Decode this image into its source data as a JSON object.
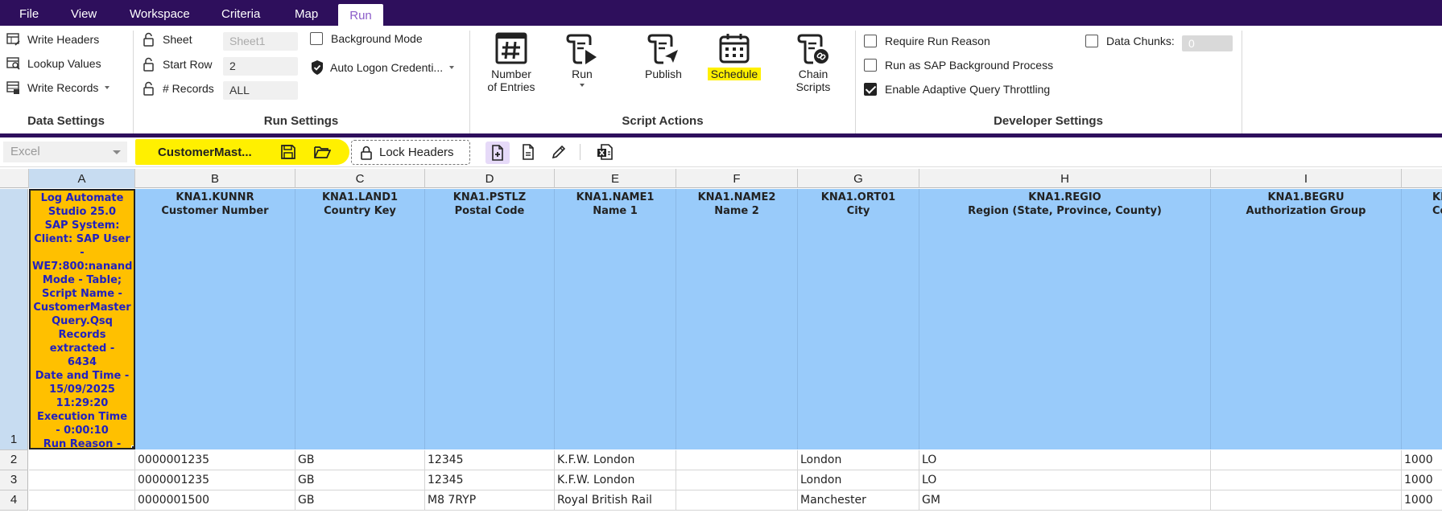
{
  "menu": [
    "File",
    "View",
    "Workspace",
    "Criteria",
    "Map",
    "Run"
  ],
  "active_menu": "Run",
  "ribbon": {
    "data_settings": {
      "title": "Data Settings",
      "write_headers": "Write Headers",
      "lookup_values": "Lookup Values",
      "write_records": "Write Records"
    },
    "run_settings": {
      "title": "Run Settings",
      "sheet_label": "Sheet",
      "sheet_value": "Sheet1",
      "start_row_label": "Start Row",
      "start_row_value": "2",
      "records_label": "# Records",
      "records_value": "ALL",
      "background_mode": "Background Mode",
      "background_mode_checked": false,
      "auto_logon": "Auto Logon Credenti...",
      "auto_logon_checked": true
    },
    "script_actions": {
      "title": "Script Actions",
      "number_of_entries_1": "Number",
      "number_of_entries_2": "of Entries",
      "run": "Run",
      "publish": "Publish",
      "schedule": "Schedule",
      "chain_scripts_1": "Chain",
      "chain_scripts_2": "Scripts"
    },
    "developer_settings": {
      "title": "Developer Settings",
      "require_run_reason": "Require Run Reason",
      "require_run_reason_checked": false,
      "run_as_sap_background": "Run as SAP Background Process",
      "run_as_sap_background_checked": false,
      "adaptive_throttling": "Enable Adaptive Query Throttling",
      "adaptive_throttling_checked": true,
      "data_chunks": "Data Chunks:",
      "data_chunks_checked": false,
      "data_chunks_value": "0"
    }
  },
  "toolbar": {
    "source": "Excel",
    "file_name": "CustomerMast...",
    "lock_headers": "Lock Headers"
  },
  "grid": {
    "columns": [
      "A",
      "B",
      "C",
      "D",
      "E",
      "F",
      "G",
      "H",
      "I"
    ],
    "rows": [
      "1",
      "2",
      "3",
      "4"
    ],
    "log_text": [
      "Log Automate",
      "Studio 25.0",
      "SAP System:",
      "Client: SAP User",
      "-",
      "WE7:800:nanand",
      "Mode  -  Table;",
      "Script Name  -",
      "CustomerMaster",
      "Query.Qsq",
      "Records",
      "extracted  -",
      "6434",
      "Date and Time  -",
      "15/09/2025",
      "11:29:20",
      "Execution Time",
      "-  0:00:10",
      "Run Reason  -"
    ],
    "headers": [
      {
        "field": "KNA1.KUNNR",
        "desc": "Customer Number"
      },
      {
        "field": "KNA1.LAND1",
        "desc": "Country Key"
      },
      {
        "field": "KNA1.PSTLZ",
        "desc": "Postal Code"
      },
      {
        "field": "KNA1.NAME1",
        "desc": "Name 1"
      },
      {
        "field": "KNA1.NAME2",
        "desc": "Name 2"
      },
      {
        "field": "KNA1.ORT01",
        "desc": "City"
      },
      {
        "field": "KNA1.REGIO",
        "desc": "Region (State, Province, County)"
      },
      {
        "field": "KNA1.BEGRU",
        "desc": "Authorization Group"
      },
      {
        "field": "KN",
        "desc": "Co"
      }
    ],
    "data": [
      [
        "",
        "0000001235",
        "GB",
        "12345",
        "K.F.W. London",
        "",
        "London",
        "LO",
        "",
        "1000"
      ],
      [
        "",
        "0000001235",
        "GB",
        "12345",
        "K.F.W. London",
        "",
        "London",
        "LO",
        "",
        "1000"
      ],
      [
        "",
        "0000001500",
        "GB",
        "M8 7RYP",
        "Royal British Rail",
        "",
        "Manchester",
        "GM",
        "",
        "1000"
      ]
    ]
  }
}
